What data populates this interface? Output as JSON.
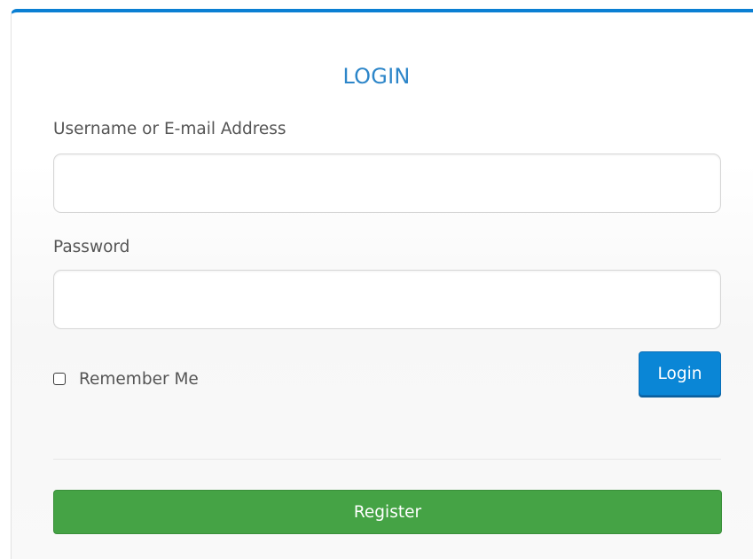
{
  "login_form": {
    "title": "LOGIN",
    "username_label": "Username or E-mail Address",
    "username_value": "",
    "password_label": "Password",
    "password_value": "",
    "remember_label": "Remember Me",
    "remember_checked": false,
    "login_button": "Login",
    "register_button": "Register"
  },
  "colors": {
    "accent_border": "#0a7fd3",
    "title": "#2d86c9",
    "login_button": "#0a86d6",
    "register_button": "#45a345"
  }
}
